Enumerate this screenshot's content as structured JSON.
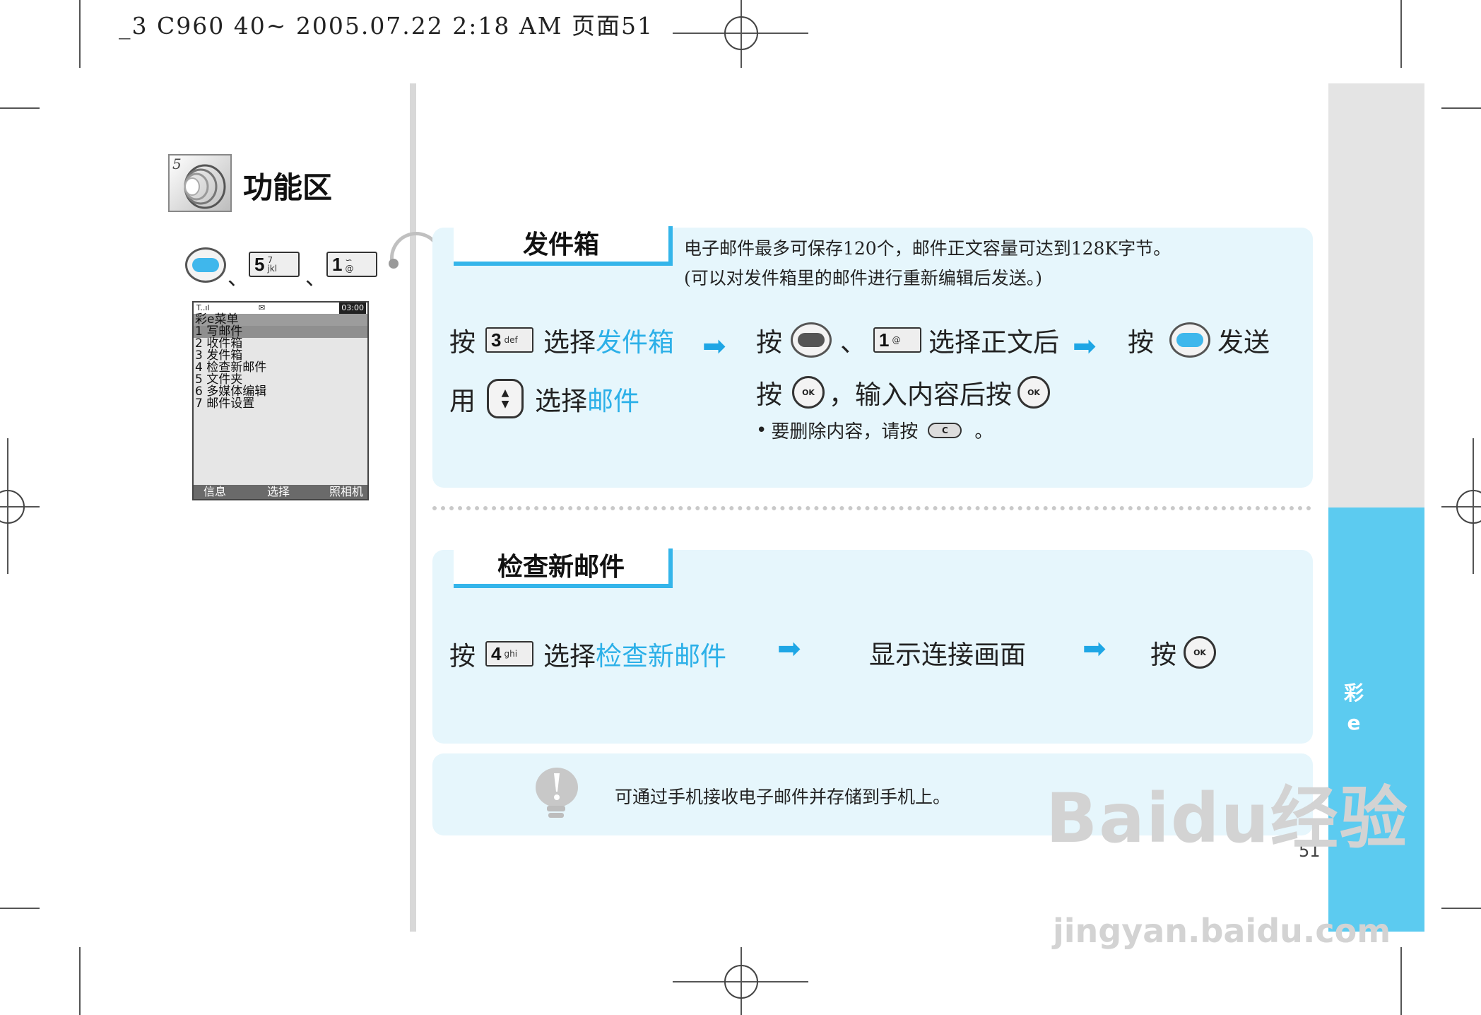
{
  "header": {
    "print_info": "_3 C960 40~  2005.07.22 2:18 AM  页面51"
  },
  "section": {
    "title": "功能区",
    "number": "5"
  },
  "path_keys": {
    "sep": "、",
    "key5": {
      "num": "5",
      "sub": "jkl",
      "sym": "7"
    },
    "key1": {
      "num": "1",
      "sub": "@",
      "sym": "∽"
    }
  },
  "phone_screen": {
    "status_signal": "T..ıl",
    "status_mid": "✉",
    "status_time": "03:00",
    "menu_title": "彩e菜单",
    "items": [
      "1 写邮件",
      "2 收件箱",
      "3 发件箱",
      "4 检查新邮件",
      "5 文件夹",
      "6 多媒体编辑",
      "7 邮件设置"
    ],
    "softkeys": [
      "信息",
      "选择",
      "照相机"
    ]
  },
  "outbox": {
    "title": "发件箱",
    "desc_line1": "电子邮件最多可保存120个，邮件正文容量可达到128K字节。",
    "desc_line2": "(可以对发件箱里的邮件进行重新编辑后发送。)",
    "step1_press": "按",
    "step1_key": {
      "num": "3",
      "sub": "def"
    },
    "step1_select": "选择",
    "step1_target": "发件箱",
    "step1b_use": "用",
    "step1b_select": "选择",
    "step1b_target": "邮件",
    "step2_press": "按",
    "step2_sep": "、",
    "step2_key": {
      "num": "1",
      "sub": "@"
    },
    "step2_text": "选择正文后",
    "step2b_press": "按",
    "step2b_comma": "，",
    "step2b_text": "输入内容后按",
    "note_text": "要删除内容，请按",
    "note_end": "。",
    "c_key": "C",
    "step3_press": "按",
    "step3_text": "发送"
  },
  "checkmail": {
    "title": "检查新邮件",
    "step1_press": "按",
    "step1_key": {
      "num": "4",
      "sub": "ghi"
    },
    "step1_select": "选择",
    "step1_target": "检查新邮件",
    "step2": "显示连接画面",
    "step3_press": "按"
  },
  "ok_label": "OK",
  "arrow_glyph": "➡",
  "tip": {
    "text": "可通过手机接收电子邮件并存储到手机上。"
  },
  "side_tab": {
    "line1": "彩",
    "line2": "e"
  },
  "page_number": "51",
  "watermark": {
    "brand": "Baidu经验",
    "url": "jingyan.baidu.com"
  },
  "colors": {
    "accent": "#34b5ea",
    "panel_bg": "#e6f6fc",
    "side_blue": "#5ccbf0",
    "highlight_text": "#2cb0e8"
  }
}
